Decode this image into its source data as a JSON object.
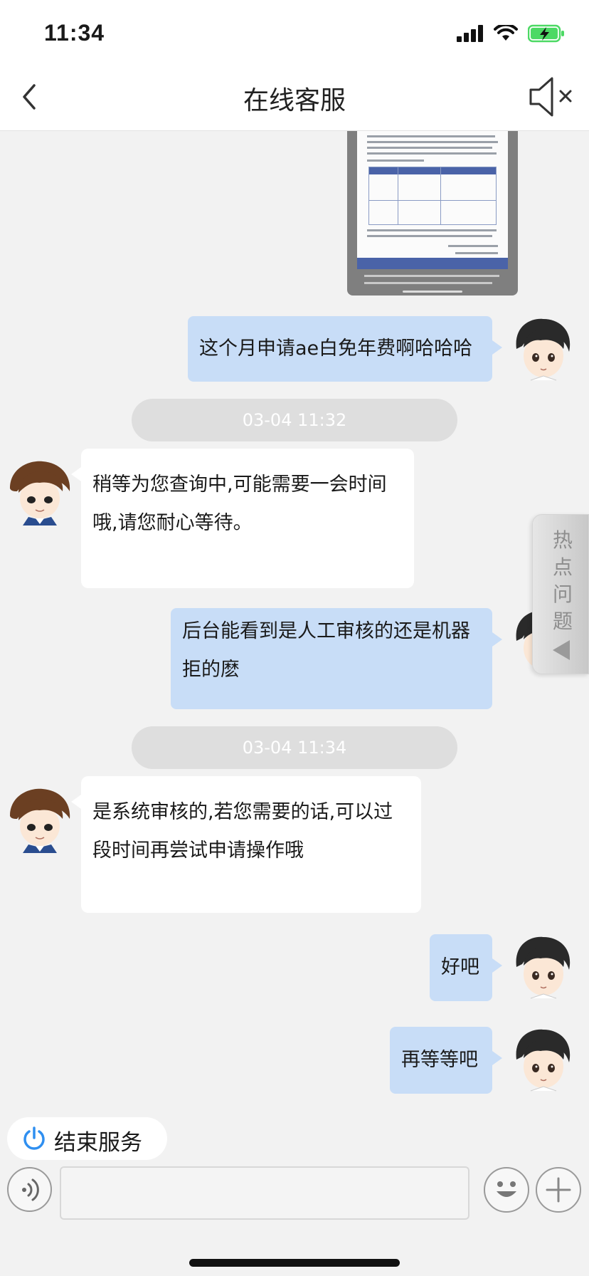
{
  "status_bar": {
    "time": "11:34",
    "icons": [
      "cellular-signal-icon",
      "wifi-icon",
      "battery-charging-icon"
    ],
    "battery_color": "#4cd964"
  },
  "nav": {
    "title": "在线客服",
    "back_icon": "chevron-left-icon",
    "mute_icon": "speaker-muted-icon"
  },
  "messages": [
    {
      "sender": "user",
      "type": "image",
      "avatar_icon": "user-avatar"
    },
    {
      "sender": "user",
      "type": "text",
      "text": "这个月申请ae白免年费啊哈哈哈"
    },
    {
      "type": "timestamp",
      "text": "03-04 11:32"
    },
    {
      "sender": "agent",
      "type": "text",
      "lines": [
        "稍等为您查询中,可能需要一会时间",
        "哦,请您耐心等待。"
      ]
    },
    {
      "sender": "user",
      "type": "text",
      "lines": [
        "后台能看到是人工审核的还是机器",
        "拒的麽"
      ]
    },
    {
      "type": "timestamp",
      "text": "03-04 11:34"
    },
    {
      "sender": "agent",
      "type": "text",
      "lines": [
        "是系统审核的,若您需要的话,可以过",
        "段时间再尝试申请操作哦"
      ]
    },
    {
      "sender": "user",
      "type": "text",
      "text": "好吧"
    },
    {
      "sender": "user",
      "type": "text",
      "text": "再等等吧"
    }
  ],
  "hot_questions": {
    "chars": [
      "热",
      "点",
      "问",
      "题"
    ],
    "arrow_icon": "triangle-left-icon"
  },
  "end_service": {
    "label": "结束服务",
    "icon": "power-icon",
    "icon_color": "#2f8ff0"
  },
  "input_bar": {
    "voice_icon": "voice-wave-icon",
    "placeholder": "",
    "emoji_icon": "smiley-icon",
    "plus_icon": "plus-icon"
  },
  "colors": {
    "user_bubble": "#c8ddf7",
    "agent_bubble": "#ffffff",
    "background": "#f2f2f2"
  }
}
